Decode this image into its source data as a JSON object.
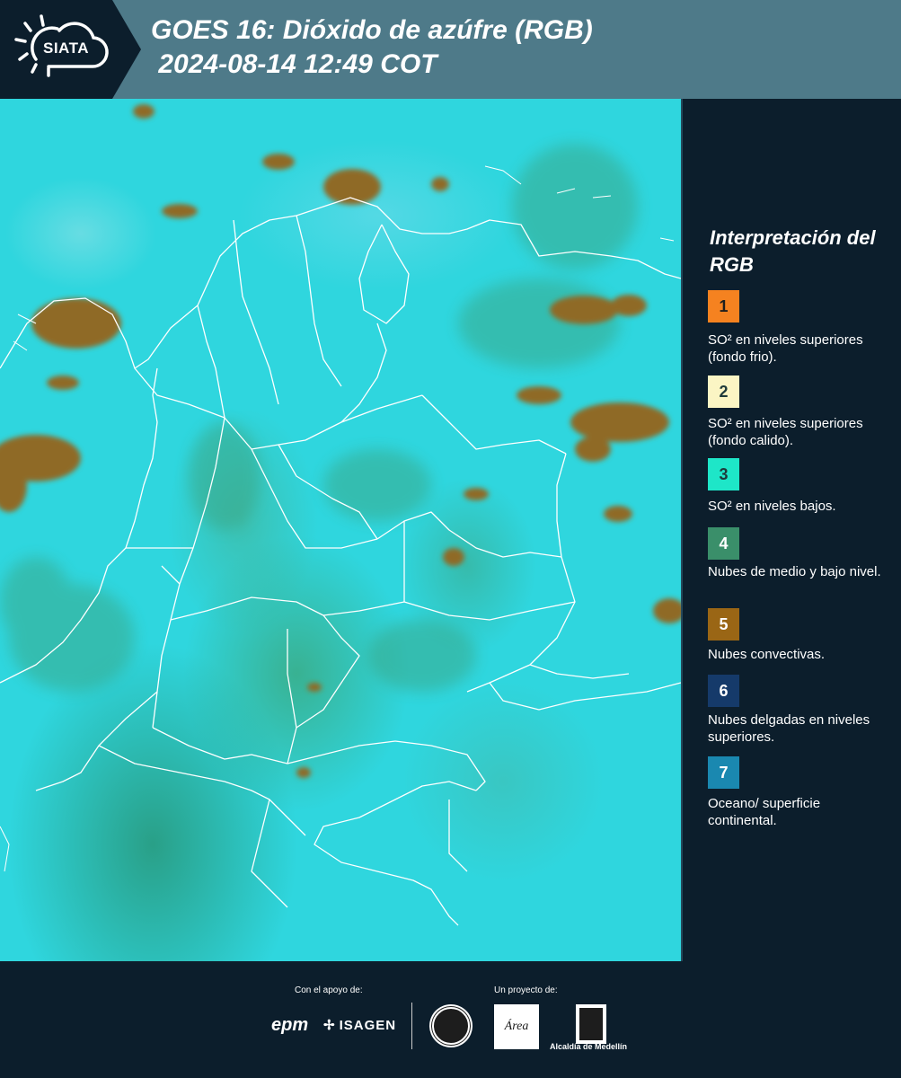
{
  "header": {
    "logo_text": "SIATA",
    "title_line1": "GOES 16: Dióxido de azúfre (RGB)",
    "title_line2": " 2024-08-14 12:49 COT"
  },
  "legend": {
    "title": "Interpretación del RGB",
    "items": [
      {
        "num": "1",
        "color": "#f58220",
        "text": "SO² en niveles superiores (fondo frio)."
      },
      {
        "num": "2",
        "color": "#fbf5c4",
        "text": "SO² en niveles superiores (fondo calido)."
      },
      {
        "num": "3",
        "color": "#1ee6c8",
        "text": "SO² en niveles bajos."
      },
      {
        "num": "4",
        "color": "#3a8f6a",
        "text": "Nubes de medio y bajo nivel."
      },
      {
        "num": "5",
        "color": "#9a6615",
        "text": "Nubes convectivas."
      },
      {
        "num": "6",
        "color": "#153a6a",
        "text": "Nubes delgadas en niveles superiores."
      },
      {
        "num": "7",
        "color": "#1a88b0",
        "text": "Oceano/ superficie continental."
      }
    ]
  },
  "footer": {
    "support_label": "Con el apoyo de:",
    "project_label": "Un proyecto de:",
    "sponsors": {
      "epm": "epm",
      "isagen": "ISAGEN"
    },
    "area_logo": "Área",
    "alcaldia_label": "Alcaldía de Medellín"
  },
  "colors": {
    "background": "#0c1e2c",
    "header": "#4e7a89",
    "map_base": "#2fd6de",
    "convective_cloud": "#8f6a25",
    "border_line": "#ffffff"
  }
}
